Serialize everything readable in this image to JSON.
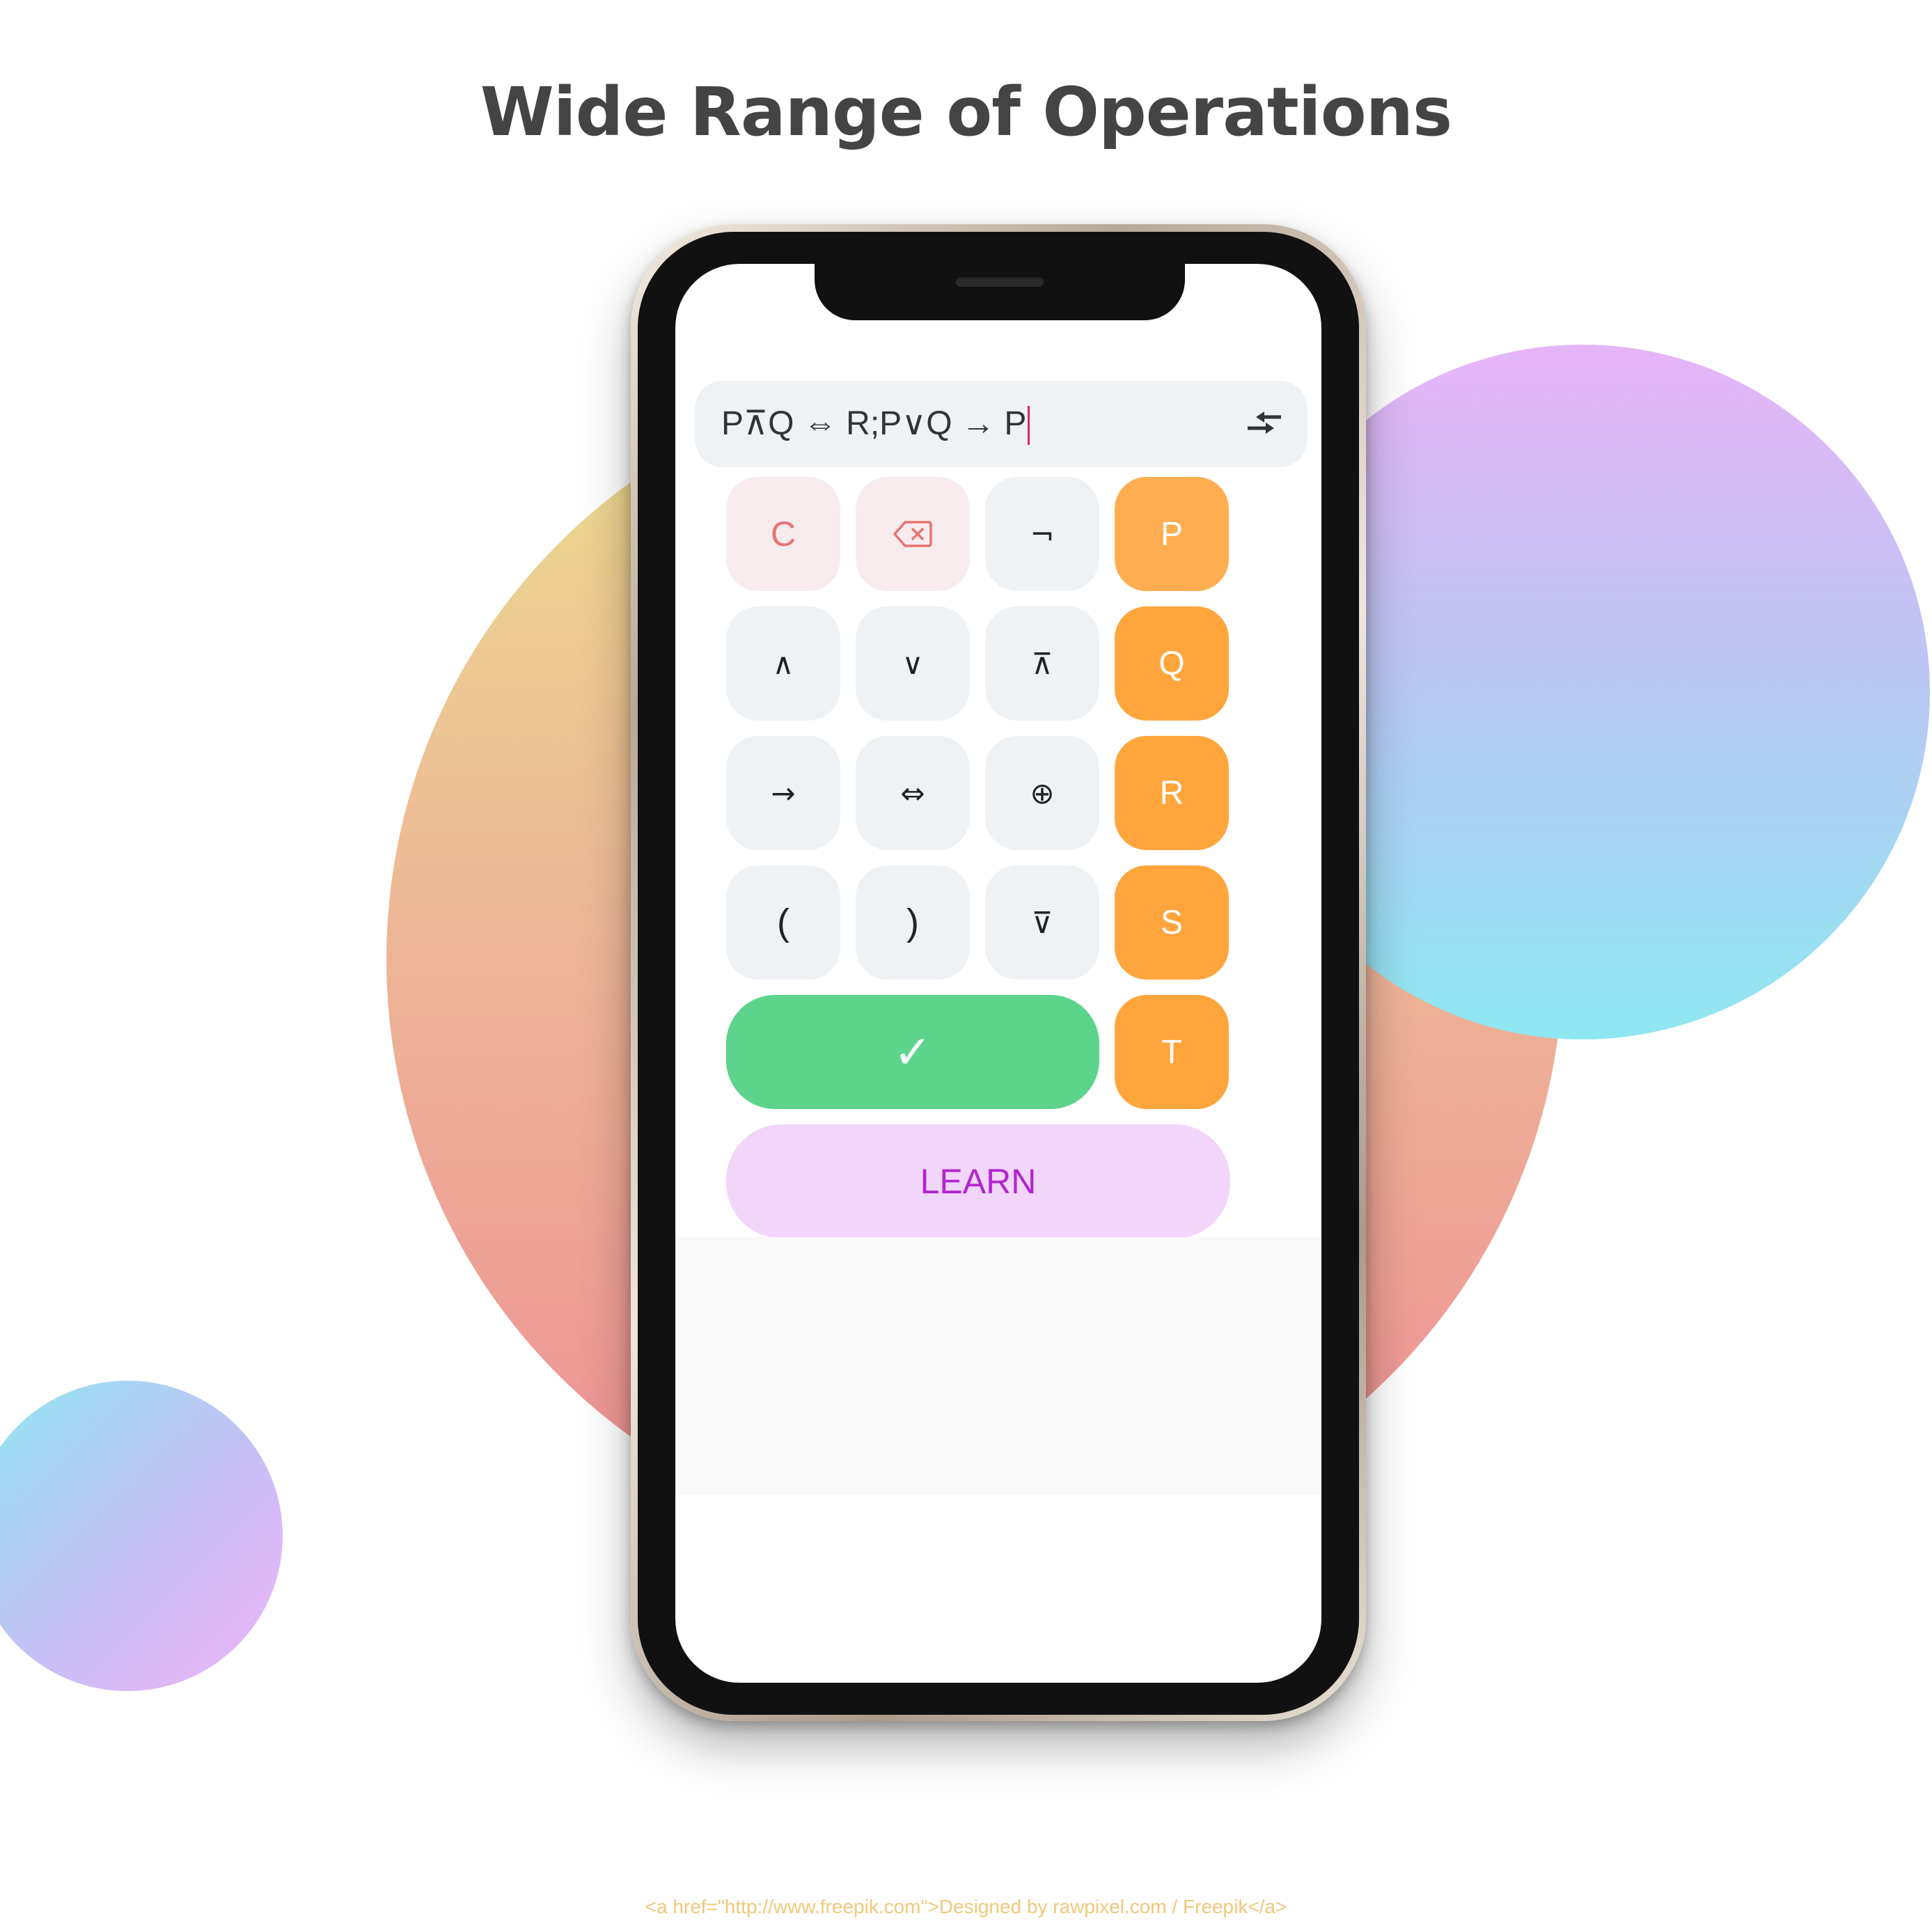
{
  "headline": "Wide Range of Operations",
  "app": {
    "expression": "P⊼Q ⇔ R;P∨Q → P",
    "swap_icon": "swap-arrows-icon",
    "keypad": {
      "row1": [
        "C",
        "backspace-icon",
        "¬",
        "P"
      ],
      "row2": [
        "∧",
        "∨",
        "⊼",
        "Q"
      ],
      "row3": [
        "→",
        "⇔",
        "⊕",
        "R"
      ],
      "row4": [
        "(",
        ")",
        "⊽",
        "S"
      ],
      "row5": [
        "✓",
        "T"
      ],
      "learn": "LEARN"
    },
    "colors": {
      "operator_key": "#eef2f5",
      "clear_key": "#f7ebed",
      "variable_key": "#ffa53c",
      "evaluate_key": "#5dd48b",
      "learn_key": "#f1d5fa",
      "learn_text": "#b325cf",
      "caret": "#e0245e"
    }
  },
  "credit": "<a href=\"http://www.freepik.com\">Designed by rawpixel.com / Freepik</a>"
}
